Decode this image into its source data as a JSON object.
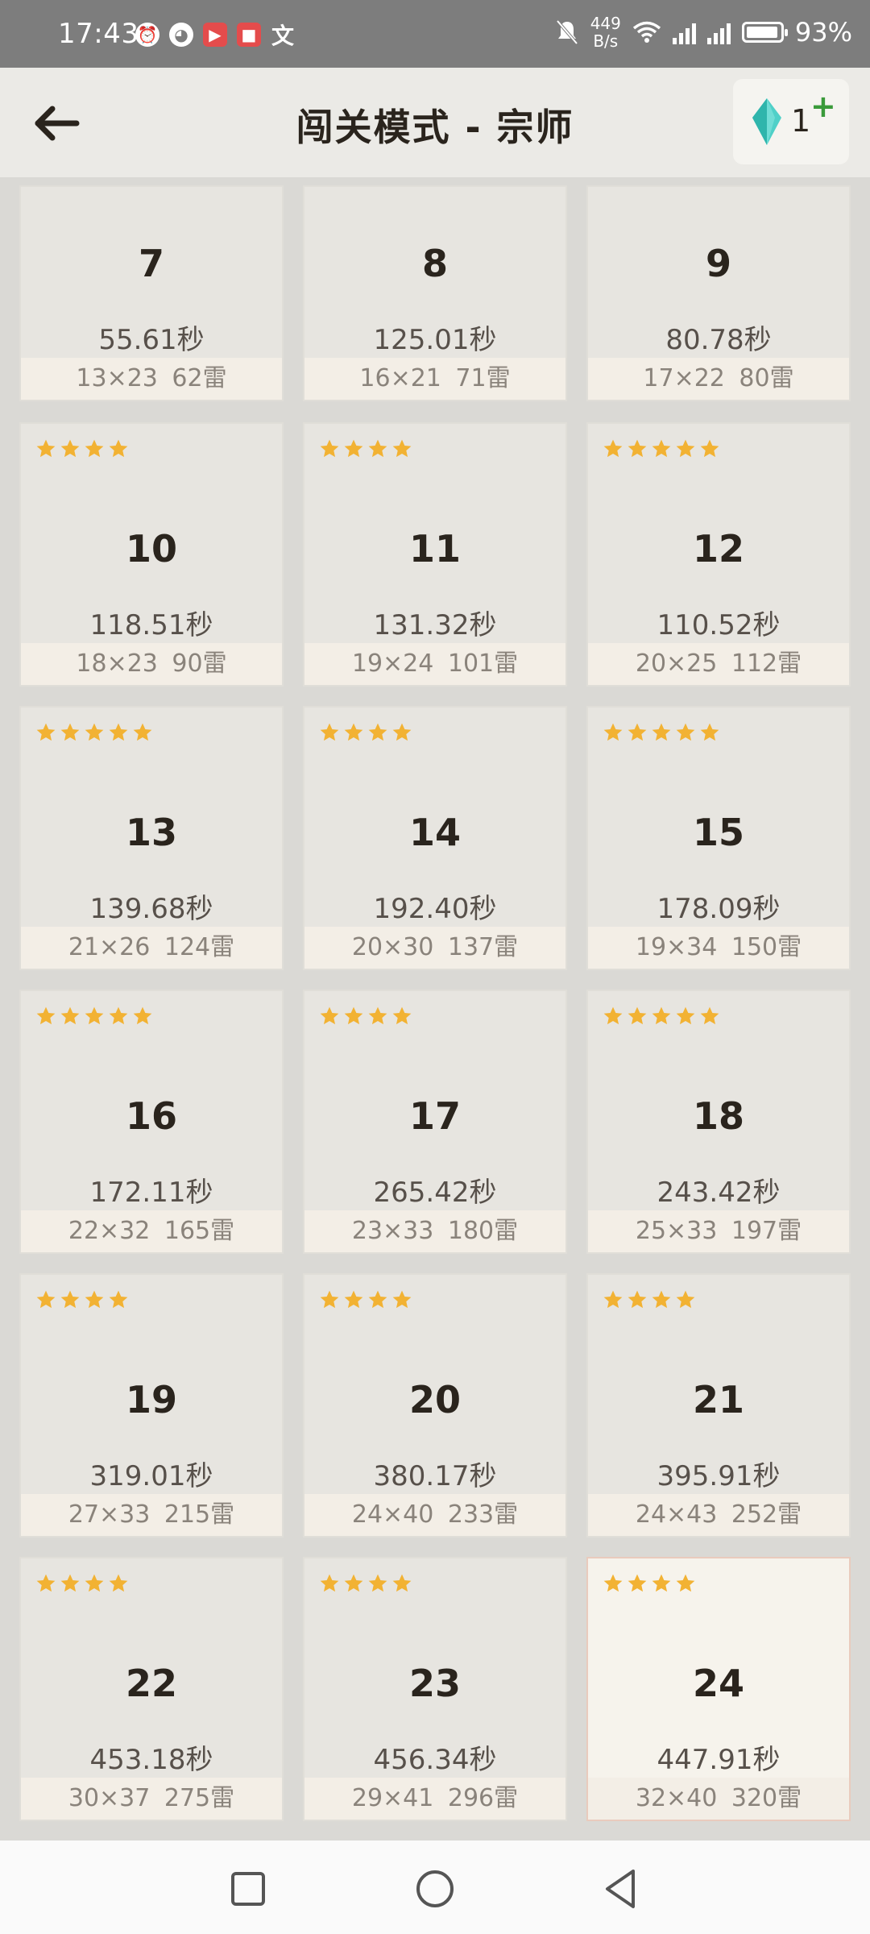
{
  "status_bar": {
    "time": "17:43",
    "net_speed_value": "449",
    "net_speed_unit": "B/s",
    "battery": "93%",
    "left_icons": [
      "alarm-icon",
      "qq-icon",
      "video-app-icon",
      "reader-app-icon",
      "translate-icon"
    ],
    "right_icons": [
      "mute-bell-icon",
      "wifi-icon",
      "signal-5g-icon",
      "signal-5g-icon",
      "battery-icon"
    ]
  },
  "header": {
    "title": "闯关模式 - 宗师",
    "gem_count": "1",
    "plus": "+"
  },
  "levels": [
    {
      "level": "7",
      "stars": 0,
      "time": "55.61秒",
      "info": "13×23 62雷"
    },
    {
      "level": "8",
      "stars": 0,
      "time": "125.01秒",
      "info": "16×21 71雷"
    },
    {
      "level": "9",
      "stars": 0,
      "time": "80.78秒",
      "info": "17×22 80雷"
    },
    {
      "level": "10",
      "stars": 4,
      "time": "118.51秒",
      "info": "18×23 90雷"
    },
    {
      "level": "11",
      "stars": 4,
      "time": "131.32秒",
      "info": "19×24 101雷"
    },
    {
      "level": "12",
      "stars": 5,
      "time": "110.52秒",
      "info": "20×25 112雷"
    },
    {
      "level": "13",
      "stars": 5,
      "time": "139.68秒",
      "info": "21×26 124雷"
    },
    {
      "level": "14",
      "stars": 4,
      "time": "192.40秒",
      "info": "20×30 137雷"
    },
    {
      "level": "15",
      "stars": 5,
      "time": "178.09秒",
      "info": "19×34 150雷"
    },
    {
      "level": "16",
      "stars": 5,
      "time": "172.11秒",
      "info": "22×32 165雷"
    },
    {
      "level": "17",
      "stars": 4,
      "time": "265.42秒",
      "info": "23×33 180雷"
    },
    {
      "level": "18",
      "stars": 5,
      "time": "243.42秒",
      "info": "25×33 197雷"
    },
    {
      "level": "19",
      "stars": 4,
      "time": "319.01秒",
      "info": "27×33 215雷"
    },
    {
      "level": "20",
      "stars": 4,
      "time": "380.17秒",
      "info": "24×40 233雷"
    },
    {
      "level": "21",
      "stars": 4,
      "time": "395.91秒",
      "info": "24×43 252雷"
    },
    {
      "level": "22",
      "stars": 4,
      "time": "453.18秒",
      "info": "30×37 275雷"
    },
    {
      "level": "23",
      "stars": 4,
      "time": "456.34秒",
      "info": "29×41 296雷"
    },
    {
      "level": "24",
      "stars": 4,
      "time": "447.91秒",
      "info": "32×40 320雷",
      "current": true
    }
  ],
  "colors": {
    "star": "#f2b233",
    "card_bg": "#e7e5e0",
    "current_card_bg": "#f6f3ec",
    "gem": "#4fd0c8",
    "plus": "#3a9a3a"
  },
  "nav": [
    "recents-square-icon",
    "home-circle-icon",
    "back-triangle-icon"
  ]
}
